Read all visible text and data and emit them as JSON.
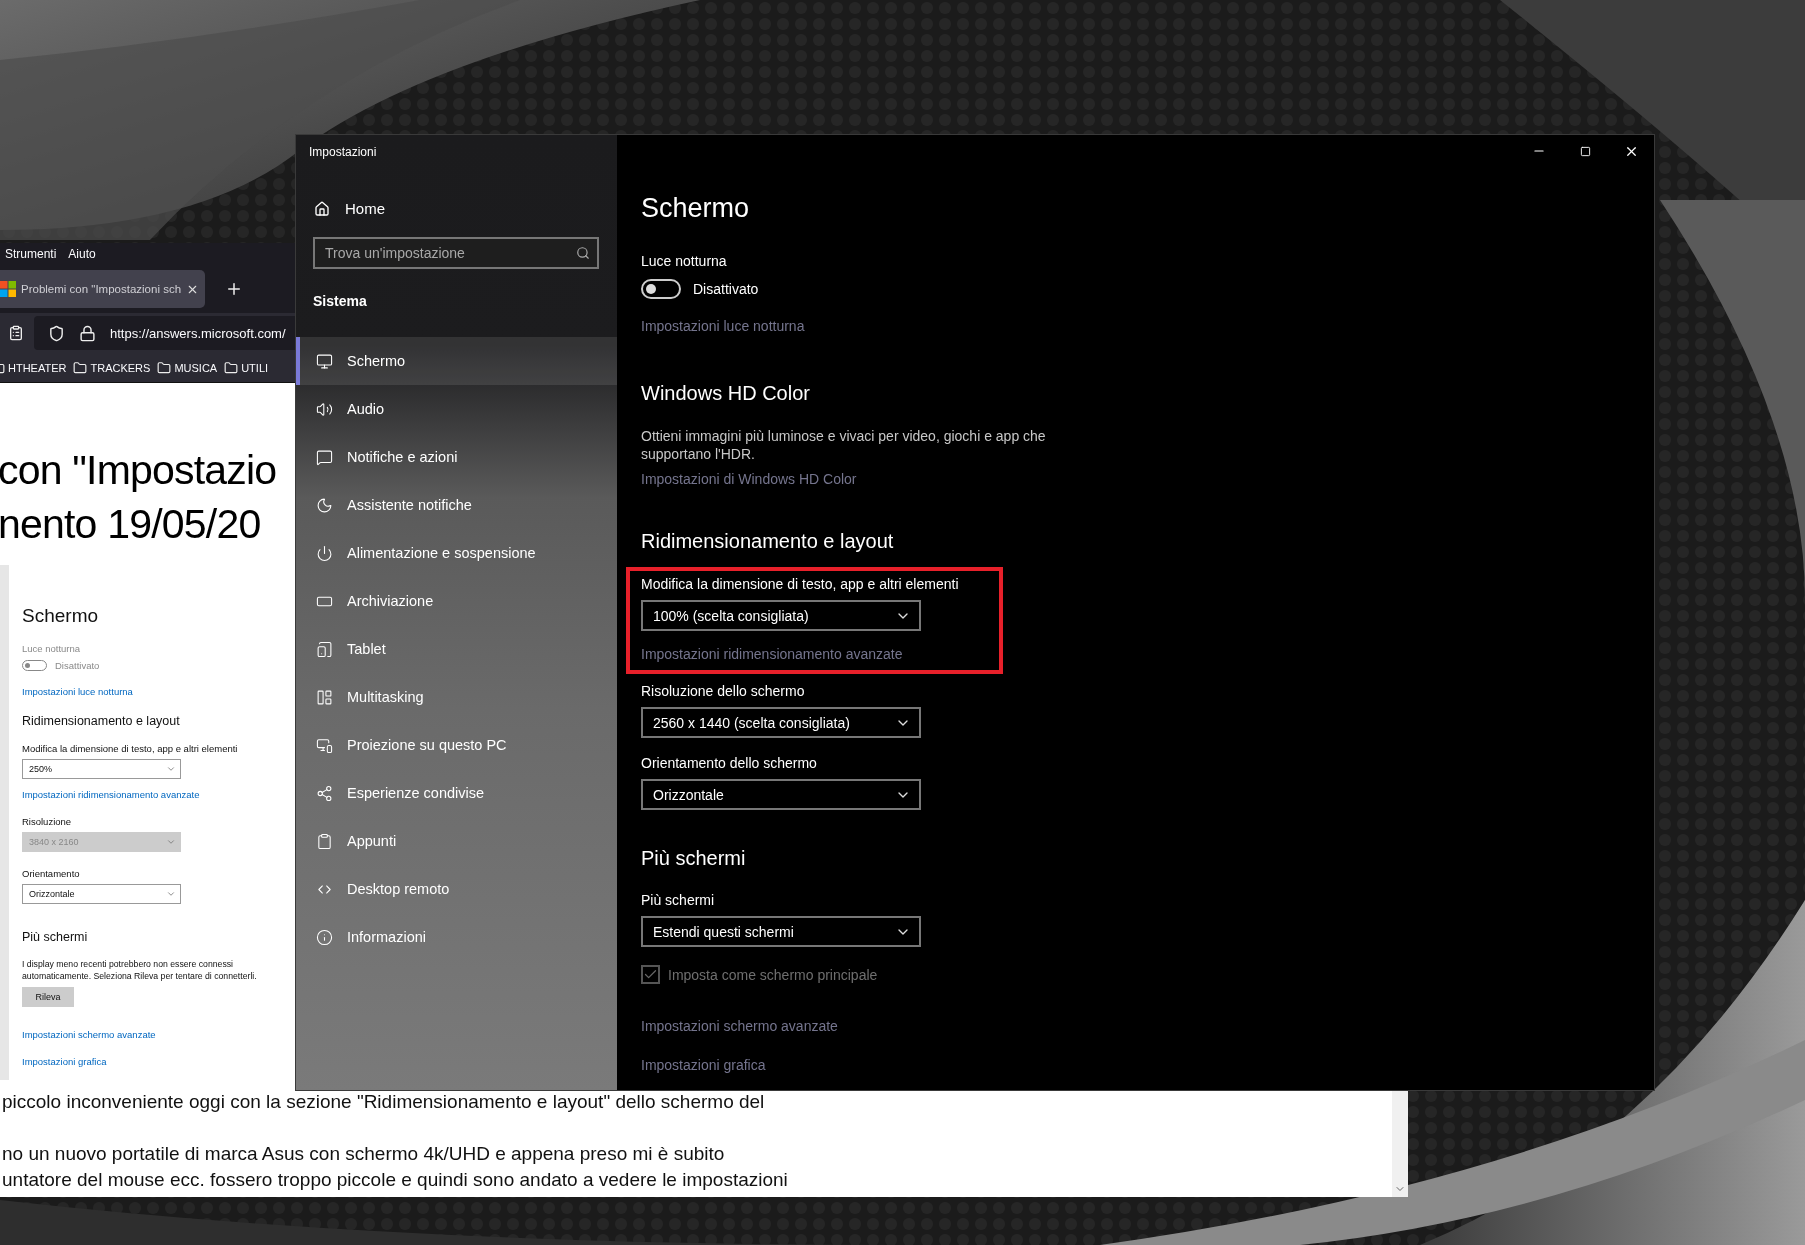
{
  "browser": {
    "menu": [
      "Strumenti",
      "Aiuto"
    ],
    "tab": {
      "title": "Problemi con \"Impostazioni sch",
      "selected": true
    },
    "address": "https://answers.microsoft.com/",
    "bookmarks": [
      "HTHEATER",
      "TRACKERS",
      "MUSICA",
      "UTILI"
    ],
    "article": {
      "title_lines": [
        "con \"Impostazio",
        "nento 19/05/20"
      ],
      "screenshot": {
        "title": "Schermo",
        "night_light_label": "Luce notturna",
        "toggle": {
          "on": false,
          "label": "Disattivato"
        },
        "night_light_link": "Impostazioni luce notturna",
        "scaling_heading": "Ridimensionamento e layout",
        "fields": [
          {
            "label": "Modifica la dimensione di testo, app e altri elementi",
            "value": "250%",
            "disabled": false,
            "link": "Impostazioni ridimensionamento avanzate"
          },
          {
            "label": "Risoluzione",
            "value": "3840 x 2160",
            "disabled": true
          },
          {
            "label": "Orientamento",
            "value": "Orizzontale",
            "disabled": false
          }
        ],
        "multi_heading": "Più schermi",
        "multi_text": "I display meno recenti potrebbero non essere connessi automaticamente. Seleziona Rileva per tentare di connetterli.",
        "detect_button": "Rileva",
        "links": [
          "Impostazioni schermo avanzate",
          "Impostazioni grafica"
        ]
      },
      "body_lines": [
        "piccolo inconveniente oggi con la sezione \"Ridimensionamento e layout\" dello schermo del",
        "no un nuovo portatile di marca Asus con schermo 4k/UHD e appena preso mi è subito",
        "untatore del mouse ecc. fossero troppo piccole e quindi sono andato a vedere le impostazioni"
      ]
    }
  },
  "settings": {
    "title": "Impostazioni",
    "home": "Home",
    "search": {
      "placeholder": "Trova un'impostazione"
    },
    "section": "Sistema",
    "items": [
      {
        "label": "Schermo",
        "selected": true
      },
      {
        "label": "Audio",
        "selected": false
      },
      {
        "label": "Notifiche e azioni",
        "selected": false
      },
      {
        "label": "Assistente notifiche",
        "selected": false
      },
      {
        "label": "Alimentazione e sospensione",
        "selected": false
      },
      {
        "label": "Archiviazione",
        "selected": false
      },
      {
        "label": "Tablet",
        "selected": false
      },
      {
        "label": "Multitasking",
        "selected": false
      },
      {
        "label": "Proiezione su questo PC",
        "selected": false
      },
      {
        "label": "Esperienze condivise",
        "selected": false
      },
      {
        "label": "Appunti",
        "selected": false
      },
      {
        "label": "Desktop remoto",
        "selected": false
      },
      {
        "label": "Informazioni",
        "selected": false
      }
    ],
    "page": {
      "title": "Schermo",
      "night_light": {
        "label": "Luce notturna",
        "toggle": {
          "on": false,
          "label": "Disattivato"
        },
        "link": "Impostazioni luce notturna"
      },
      "hd_color": {
        "heading": "Windows HD Color",
        "description": "Ottieni immagini più luminose e vivaci per video, giochi e app che supportano l'HDR.",
        "link": "Impostazioni di Windows HD Color"
      },
      "scaling": {
        "heading": "Ridimensionamento e layout",
        "fields": [
          {
            "label": "Modifica la dimensione di testo, app e altri elementi",
            "value": "100% (scelta consigliata)",
            "link": "Impostazioni ridimensionamento avanzate",
            "highlighted": true
          },
          {
            "label": "Risoluzione dello schermo",
            "value": "2560 x 1440 (scelta consigliata)",
            "highlighted": false
          },
          {
            "label": "Orientamento dello schermo",
            "value": "Orizzontale",
            "highlighted": false
          }
        ]
      },
      "multi": {
        "heading": "Più schermi",
        "label": "Più schermi",
        "value": "Estendi questi schermi",
        "checkbox": {
          "label": "Imposta come schermo principale",
          "checked": true,
          "disabled": true
        },
        "links": [
          "Impostazioni schermo avanzate",
          "Impostazioni grafica"
        ]
      }
    }
  }
}
